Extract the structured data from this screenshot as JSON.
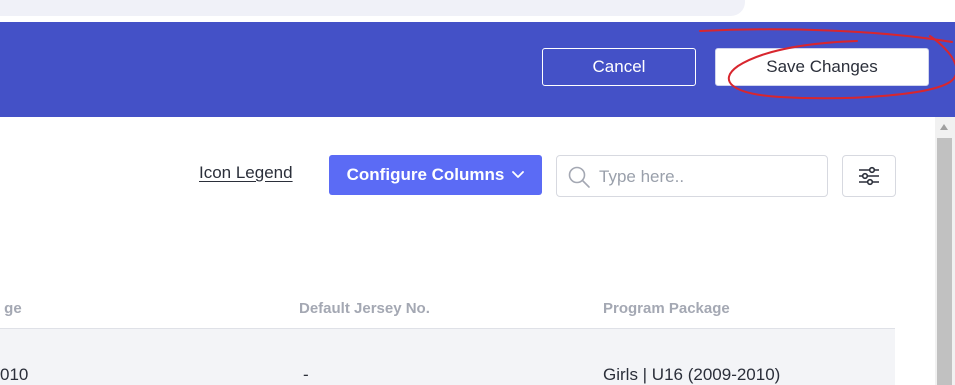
{
  "header": {
    "cancel_label": "Cancel",
    "save_label": "Save Changes",
    "background_color": "#4451c7"
  },
  "toolbar": {
    "icon_legend_label": "Icon Legend",
    "configure_columns_label": "Configure Columns",
    "configure_columns_color": "#5b6bf5",
    "search_placeholder": "Type here..",
    "search_value": ""
  },
  "table": {
    "columns": [
      " ge",
      "Default Jersey No.",
      "Program Package"
    ],
    "rows": [
      [
        "010",
        "-",
        "Girls | U16 (2009-2010)"
      ]
    ]
  },
  "annotation": {
    "color": "#d8262e",
    "shape": "hand-drawn-ellipse"
  }
}
